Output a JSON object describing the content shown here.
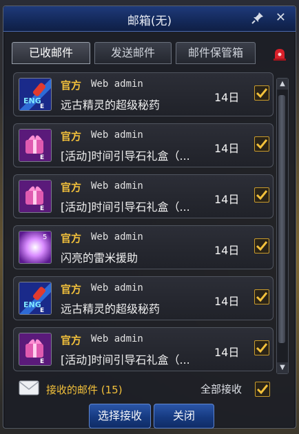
{
  "window": {
    "title": "邮箱(无)"
  },
  "tabs": [
    {
      "label": "已收邮件",
      "active": true
    },
    {
      "label": "发送邮件",
      "active": false
    },
    {
      "label": "邮件保管箱",
      "active": false
    }
  ],
  "mails": [
    {
      "sender_tag": "官方",
      "sender": "Web admin",
      "subject": "远古精灵的超级秘药",
      "days": "14日",
      "icon": "potion-icon",
      "checked": true
    },
    {
      "sender_tag": "官方",
      "sender": "Web admin",
      "subject": "[活动]时间引导石礼盒（...",
      "days": "14日",
      "icon": "gift-box-icon",
      "checked": true
    },
    {
      "sender_tag": "官方",
      "sender": "Web admin",
      "subject": "[活动]时间引导石礼盒（...",
      "days": "14日",
      "icon": "gift-box-icon",
      "checked": true
    },
    {
      "sender_tag": "官方",
      "sender": "Web admin",
      "subject": "闪亮的雷米援助",
      "days": "14日",
      "icon": "sparkle-icon",
      "count": "5",
      "checked": true
    },
    {
      "sender_tag": "官方",
      "sender": "Web admin",
      "subject": "远古精灵的超级秘药",
      "days": "14日",
      "icon": "potion-icon",
      "checked": true
    },
    {
      "sender_tag": "官方",
      "sender": "Web admin",
      "subject": "[活动]时间引导石礼盒（...",
      "days": "14日",
      "icon": "gift-box-icon",
      "checked": true
    }
  ],
  "footer": {
    "received_label": "接收的邮件 (15)",
    "select_all_label": "全部接收",
    "select_all_checked": true,
    "select_receive_button": "选择接收",
    "close_button": "关闭"
  },
  "colors": {
    "accent_gold": "#f3c13b",
    "title_blue": "#1f3a7a",
    "button_blue": "#2b56a8"
  }
}
